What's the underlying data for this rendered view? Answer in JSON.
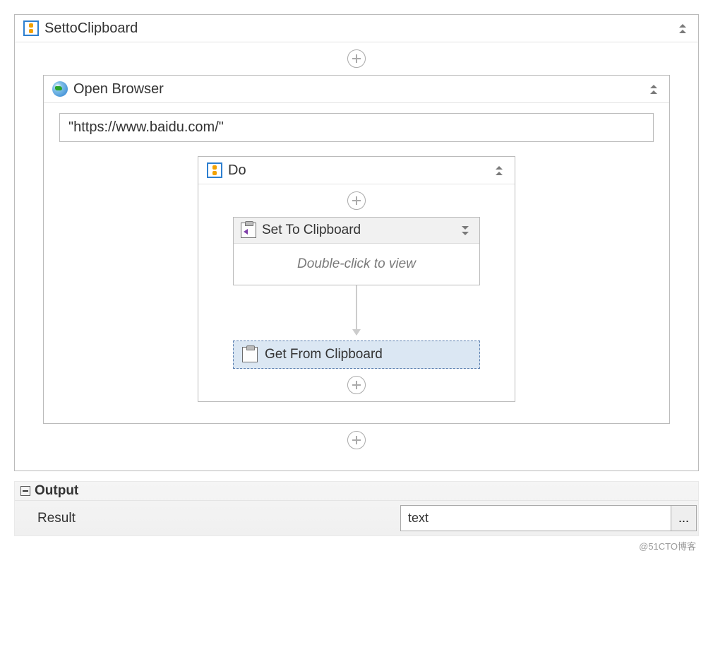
{
  "root": {
    "title": "SettoClipboard"
  },
  "browser": {
    "title": "Open Browser",
    "url": "\"https://www.baidu.com/\""
  },
  "do": {
    "title": "Do"
  },
  "setClip": {
    "title": "Set To Clipboard",
    "hint": "Double-click to view"
  },
  "getClip": {
    "title": "Get From Clipboard"
  },
  "output": {
    "section": "Output",
    "rowLabel": "Result",
    "value": "text",
    "browse": "..."
  },
  "watermark": "@51CTO博客"
}
